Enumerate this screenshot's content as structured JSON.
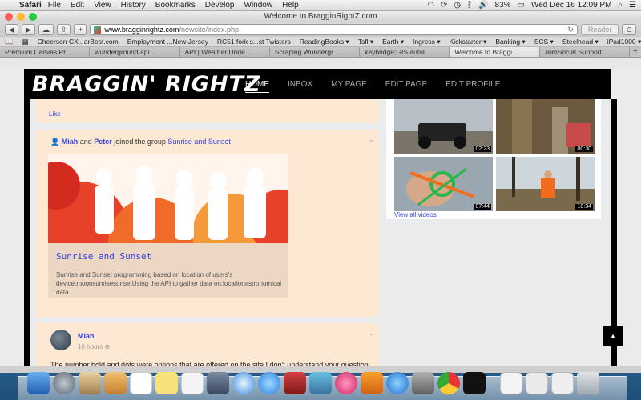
{
  "menubar": {
    "app": "Safari",
    "menus": [
      "File",
      "Edit",
      "View",
      "History",
      "Bookmarks",
      "Develop",
      "Window",
      "Help"
    ],
    "battery": "83%",
    "clock": "Wed Dec 16  12:09 PM"
  },
  "window": {
    "title": "Welcome to BragginRightZ.com",
    "url_host": "www.bragginrightz.com",
    "url_path": "/newsite/index.php",
    "reader_label": "Reader"
  },
  "bookmarks": [
    "Cheerson CX...arBest.com",
    "Employment ...New Jersey",
    "RC51 fork s...st Twisters",
    "ReadingBooks ▾",
    "Tsfl ▾",
    "Earth ▾",
    "Ingress ▾",
    "Kickstarter ▾",
    "Banking ▾",
    "SCS ▾",
    "Steelhead ▾",
    "iPad1000 ▾"
  ],
  "tabs": [
    "Premium Canvas Pr...",
    "wunderground api...",
    "API | Weather Unde...",
    "Scraping Wundergr...",
    "keybridge;GIS autol...",
    "Welcome to Braggi...",
    "JomSocial Support..."
  ],
  "site": {
    "logo": "BRAGGIN' RIGHTZ",
    "nav": [
      "HOME",
      "INBOX",
      "MY PAGE",
      "EDIT PAGE",
      "EDIT PROFILE"
    ]
  },
  "feed": {
    "like": "Like",
    "activity": {
      "actor1": "Miah",
      "and": " and ",
      "actor2": "Peter",
      "verb": " joined the group ",
      "group": "Sunrise and Sunset"
    },
    "group_card": {
      "title": "Sunrise and Sunset",
      "desc": "Sunrise and Sunset programming based on location of users's device.moonsunrisesunsetUsing the API to gather data on:locationastronomical data"
    },
    "post": {
      "author": "Miah",
      "time": "10 hours",
      "text": "The number bold and dots were options that are offered on the site I don't understand your question \"what I used\" none of them showed up when posted"
    }
  },
  "videos": {
    "durations": [
      "02:23",
      "00:30",
      "07:44",
      "18:34"
    ],
    "view_all": "View all videos"
  }
}
